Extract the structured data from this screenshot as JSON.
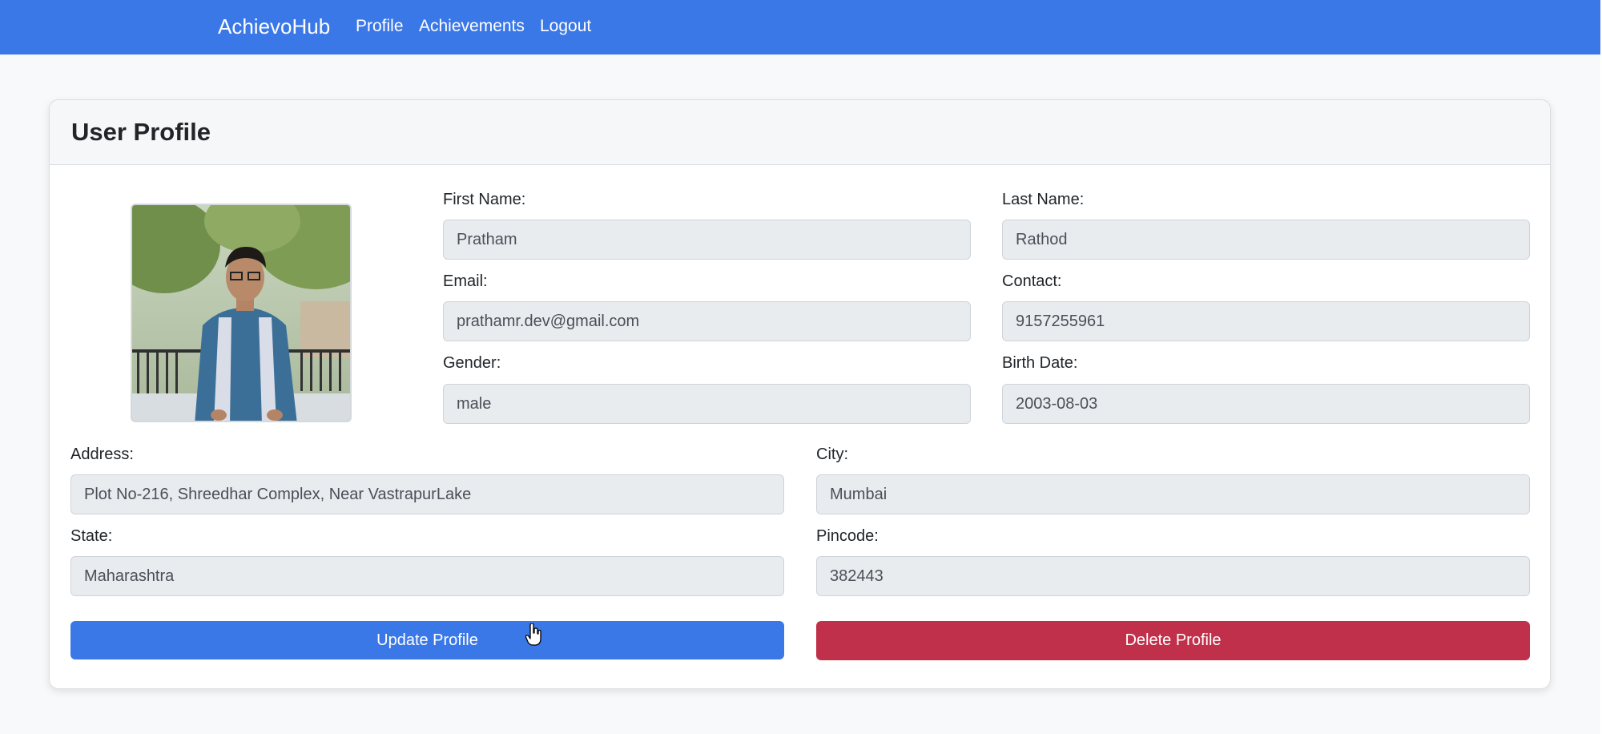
{
  "navbar": {
    "brand": "AchievoHub",
    "links": [
      "Profile",
      "Achievements",
      "Logout"
    ],
    "color": "#3b78e7"
  },
  "profile": {
    "title": "User Profile",
    "fields": {
      "first_name": {
        "label": "First Name:",
        "value": "Pratham"
      },
      "last_name": {
        "label": "Last Name:",
        "value": "Rathod"
      },
      "email": {
        "label": "Email:",
        "value": "prathamr.dev@gmail.com"
      },
      "contact": {
        "label": "Contact:",
        "value": "9157255961"
      },
      "gender": {
        "label": "Gender:",
        "value": "male"
      },
      "birth_date": {
        "label": "Birth Date:",
        "value": "2003-08-03"
      },
      "address": {
        "label": "Address:",
        "value": "Plot No-216, Shreedhar Complex, Near VastrapurLake"
      },
      "city": {
        "label": "City:",
        "value": "Mumbai"
      },
      "state": {
        "label": "State:",
        "value": "Maharashtra"
      },
      "pincode": {
        "label": "Pincode:",
        "value": "382443"
      }
    },
    "buttons": {
      "update": "Update Profile",
      "delete": "Delete Profile"
    },
    "colors": {
      "update": "#3b78e7",
      "delete": "#c1304a"
    }
  },
  "icons": {
    "cursor": "hand-pointer-icon"
  }
}
